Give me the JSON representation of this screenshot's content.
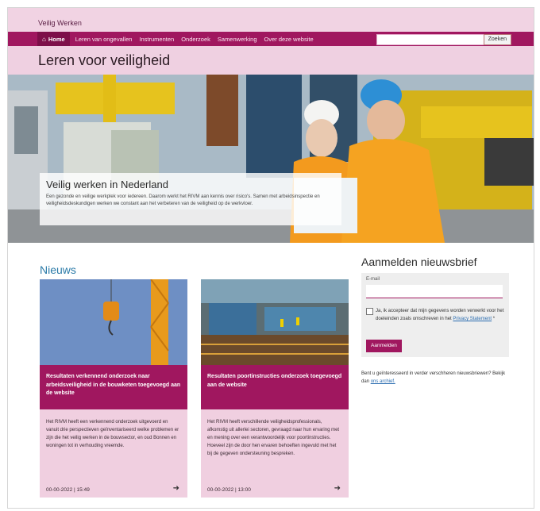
{
  "site": {
    "brand": "Veilig Werken",
    "nav": [
      "Home",
      "Leren van ongevallen",
      "Instrumenten",
      "Onderzoek",
      "Samenwerking",
      "Over deze website"
    ],
    "search": {
      "placeholder": "",
      "button": "Zoeken"
    },
    "page_title": "Leren voor veiligheid"
  },
  "hero": {
    "title": "Veilig werken in Nederland",
    "text": "Een gezonde en veilige werkplek voor iedereen. Daarom werkt het RIVM aan kennis over risico's. Samen met arbeidsinspectie en veiligheidsdeskundigen werken we constant aan het verbeteren van de veiligheid op de werkvloer."
  },
  "news": {
    "title": "Nieuws",
    "cards": [
      {
        "headline": "Resultaten verkennend onderzoek naar arbeidsveiligheid in de bouwketen toegevoegd aan de website",
        "body": "Het RIVM heeft een verkennend onderzoek uitgevoerd en vanuit drie perspectieven geïnventariseerd welke problemen er zijn die het veilig werken in de bouwsector, en oud Bonnen en woningen tot in verhouding vreemde.",
        "date": "00-00-2022 | 15:49",
        "arrow": "➜"
      },
      {
        "headline": "Resultaten poortinstructies onderzoek toegevoegd aan de website",
        "body": "Het RIVM heeft verschillende veiligheidsprofessionals, afkomstig uit allerlei sectoren, gevraagd naar hun ervaring met en mening over een verantwoordelijk voor poortinstructies. Hoeveel zijn de door hen ervaren behoeften ingevuld met het bij de gegeven ondersteuning bespreken.",
        "date": "00-00-2022 | 13:00",
        "arrow": "➜"
      }
    ]
  },
  "newsletter": {
    "title": "Aanmelden nieuwsbrief",
    "email_label": "E-mail",
    "email_value": "",
    "consent": "Ja, ik accepteer dat mijn gegevens worden verwerkt voor het doeleinden zoals omschreven in het",
    "privacy_link": "Privacy Statement",
    "required_mark": "*",
    "button": "Aanmelden",
    "note": "Bent u geïnteresseerd in verder verschheren nieuwsbriewen? Bekijk dan",
    "note_link": "ons archief."
  },
  "colors": {
    "brand": "#a0175f",
    "light_band": "#f1d3e3",
    "news_title": "#2b7ba8",
    "card_bg": "#f0cfe0"
  },
  "icons": {
    "home": "home-icon",
    "arrow": "arrow-right-icon"
  }
}
